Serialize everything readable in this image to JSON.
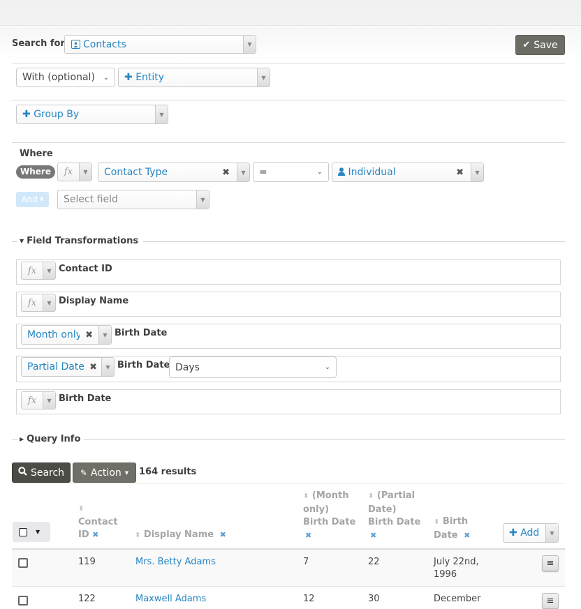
{
  "header": {
    "search_for_label": "Search for",
    "entity": "Contacts",
    "entity_icon": "address-card-icon",
    "save_label": "Save",
    "save_icon": "check-icon"
  },
  "joins": {
    "with_select": "With (optional)",
    "entity_placeholder": "Entity"
  },
  "group_by": {
    "label": "Group By"
  },
  "where": {
    "heading": "Where",
    "badge": "Where",
    "fx": "fx",
    "field": "Contact Type",
    "operator": "=",
    "value": "Individual",
    "value_icon": "user-icon",
    "and_label": "And",
    "select_field_placeholder": "Select field"
  },
  "field_transformations": {
    "title": "Field Transformations",
    "rows": [
      {
        "transform": "fx",
        "field": "Contact ID"
      },
      {
        "transform": "fx",
        "field": "Display Name"
      },
      {
        "transform": "Month only",
        "field": "Birth Date"
      },
      {
        "transform": "Partial Date",
        "field": "Birth Date",
        "option": "Days"
      },
      {
        "transform": "fx",
        "field": "Birth Date"
      }
    ]
  },
  "query_info": {
    "title": "Query Info"
  },
  "toolbar": {
    "search_label": "Search",
    "action_label": "Action",
    "results_count": "164 results"
  },
  "table": {
    "columns": [
      {
        "line1": "Contact",
        "line2": "ID"
      },
      {
        "label": "Display Name"
      },
      {
        "line1": "(Month",
        "line2": "only)",
        "line3": "Birth Date"
      },
      {
        "line1": "(Partial",
        "line2": "Date)",
        "line3": "Birth Date"
      },
      {
        "line1": "Birth",
        "line2": "Date"
      }
    ],
    "add_label": "Add",
    "rows": [
      {
        "id": "119",
        "name": "Mrs. Betty Adams",
        "month": "7",
        "partial": "22",
        "birth_line1": "July 22nd,",
        "birth_line2": "1996"
      },
      {
        "id": "122",
        "name": "Maxwell Adams",
        "month": "12",
        "partial": "30",
        "birth_line1": "December",
        "birth_line2": ""
      }
    ]
  }
}
